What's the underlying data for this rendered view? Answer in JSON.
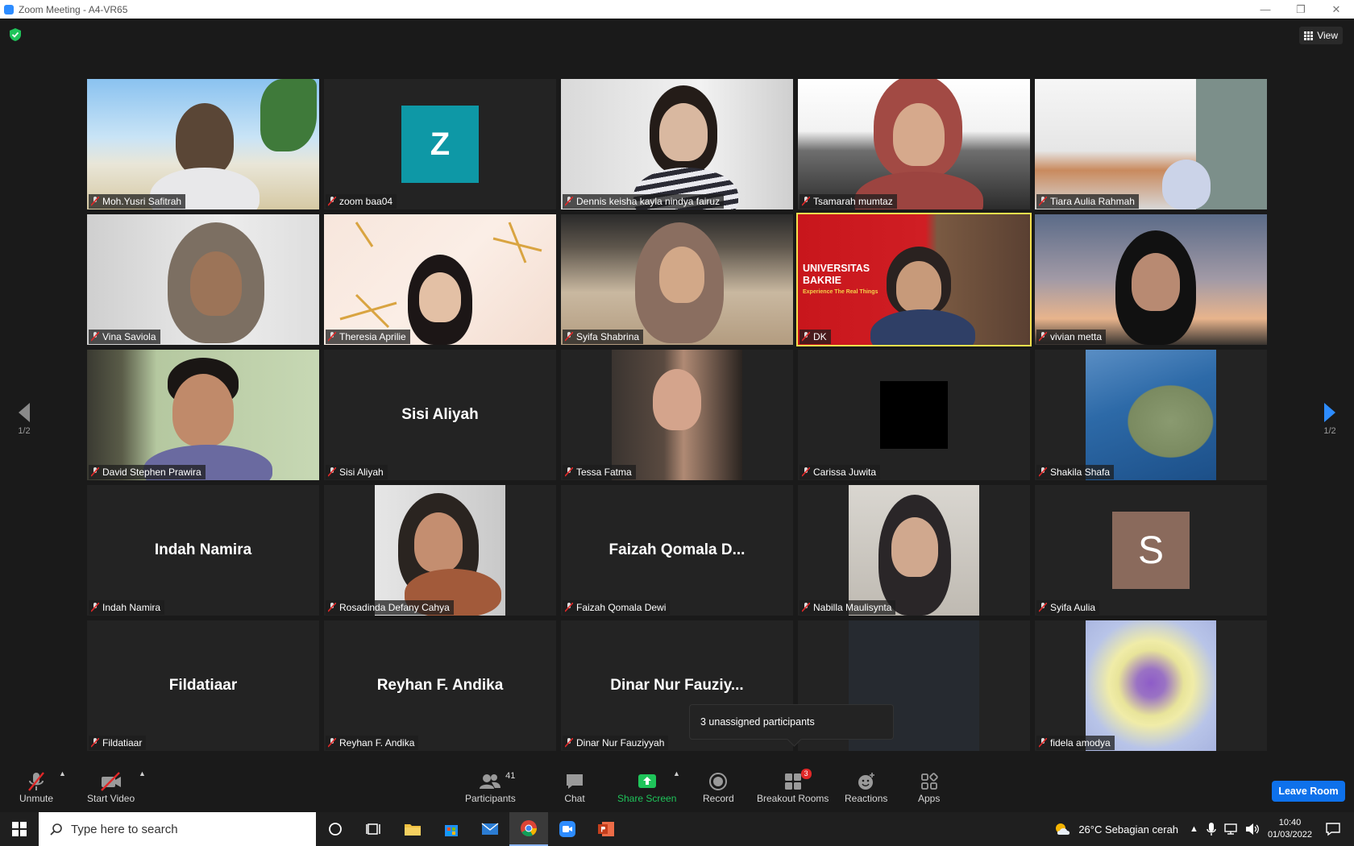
{
  "window": {
    "title": "Zoom Meeting - A4-VR65"
  },
  "top": {
    "view_label": "View"
  },
  "pager": {
    "left": "1/2",
    "right": "1/2"
  },
  "tiles": [
    {
      "name": "Moh.Yusri Safitrah"
    },
    {
      "name": "zoom baa04",
      "avatar_letter": "Z",
      "avatar_color": "#0e98a6"
    },
    {
      "name": "Dennis keisha kayla nindya fairuz"
    },
    {
      "name": "Tsamarah mumtaz"
    },
    {
      "name": "Tiara Aulia Rahmah"
    },
    {
      "name": "Vina Saviola"
    },
    {
      "name": "Theresia Aprilie"
    },
    {
      "name": "Syifa Shabrina"
    },
    {
      "name": "DK",
      "banner_title": "UNIVERSITAS BAKRIE",
      "banner_sub": "Experience The Real Things"
    },
    {
      "name": "vivian metta"
    },
    {
      "name": "David Stephen Prawira"
    },
    {
      "name": "Sisi Aliyah",
      "display_name": "Sisi Aliyah"
    },
    {
      "name": "Tessa Fatma"
    },
    {
      "name": "Carissa Juwita"
    },
    {
      "name": "Shakila Shafa"
    },
    {
      "name": "Indah Namira",
      "display_name": "Indah Namira"
    },
    {
      "name": "Rosadinda Defany Cahya"
    },
    {
      "name": "Faizah Qomala Dewi",
      "display_name": "Faizah Qomala D..."
    },
    {
      "name": "Nabilla Maulisynta"
    },
    {
      "name": "Syifa Aulia",
      "avatar_letter": "S",
      "avatar_color": "#8a6a5c"
    },
    {
      "name": "Fildatiaar",
      "display_name": "Fildatiaar"
    },
    {
      "name": "Reyhan F. Andika",
      "display_name": "Reyhan F. Andika"
    },
    {
      "name": "Dinar Nur Fauziyyah",
      "display_name": "Dinar Nur Fauziy..."
    },
    {
      "name": ""
    },
    {
      "name": "fidela amodya"
    }
  ],
  "tooltip": {
    "text": "3 unassigned participants"
  },
  "toolbar": {
    "unmute": "Unmute",
    "start_video": "Start Video",
    "participants": "Participants",
    "participants_count": "41",
    "chat": "Chat",
    "share_screen": "Share Screen",
    "record": "Record",
    "breakout_rooms": "Breakout Rooms",
    "breakout_badge": "3",
    "reactions": "Reactions",
    "apps": "Apps",
    "leave_room": "Leave Room"
  },
  "taskbar": {
    "search_placeholder": "Type here to search",
    "weather": "26°C  Sebagian cerah",
    "time": "10:40",
    "date": "01/03/2022"
  },
  "colors": {
    "accent": "#0e71eb",
    "active_speaker": "#f4e04d",
    "share_green": "#1fc45a"
  }
}
